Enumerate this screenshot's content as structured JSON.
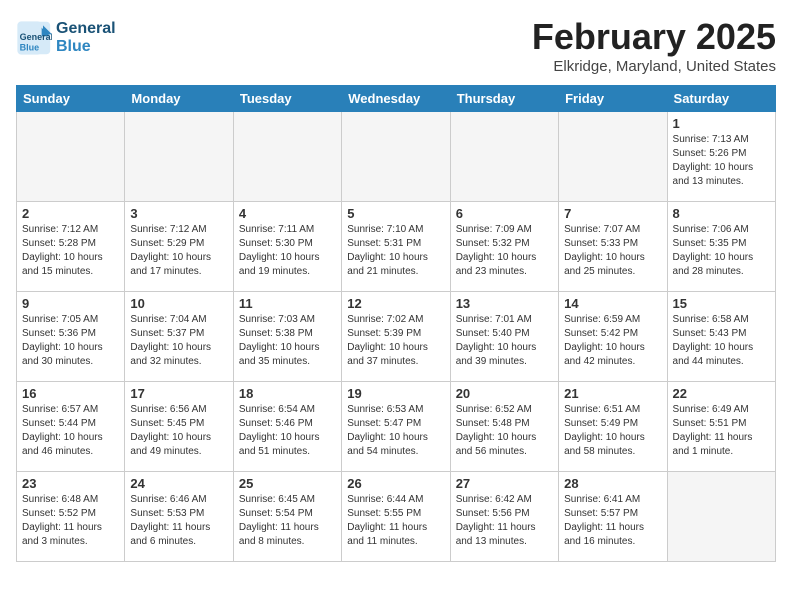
{
  "header": {
    "logo_line1": "General",
    "logo_line2": "Blue",
    "title": "February 2025",
    "subtitle": "Elkridge, Maryland, United States"
  },
  "weekdays": [
    "Sunday",
    "Monday",
    "Tuesday",
    "Wednesday",
    "Thursday",
    "Friday",
    "Saturday"
  ],
  "weeks": [
    [
      {
        "day": "",
        "info": ""
      },
      {
        "day": "",
        "info": ""
      },
      {
        "day": "",
        "info": ""
      },
      {
        "day": "",
        "info": ""
      },
      {
        "day": "",
        "info": ""
      },
      {
        "day": "",
        "info": ""
      },
      {
        "day": "1",
        "info": "Sunrise: 7:13 AM\nSunset: 5:26 PM\nDaylight: 10 hours\nand 13 minutes."
      }
    ],
    [
      {
        "day": "2",
        "info": "Sunrise: 7:12 AM\nSunset: 5:28 PM\nDaylight: 10 hours\nand 15 minutes."
      },
      {
        "day": "3",
        "info": "Sunrise: 7:12 AM\nSunset: 5:29 PM\nDaylight: 10 hours\nand 17 minutes."
      },
      {
        "day": "4",
        "info": "Sunrise: 7:11 AM\nSunset: 5:30 PM\nDaylight: 10 hours\nand 19 minutes."
      },
      {
        "day": "5",
        "info": "Sunrise: 7:10 AM\nSunset: 5:31 PM\nDaylight: 10 hours\nand 21 minutes."
      },
      {
        "day": "6",
        "info": "Sunrise: 7:09 AM\nSunset: 5:32 PM\nDaylight: 10 hours\nand 23 minutes."
      },
      {
        "day": "7",
        "info": "Sunrise: 7:07 AM\nSunset: 5:33 PM\nDaylight: 10 hours\nand 25 minutes."
      },
      {
        "day": "8",
        "info": "Sunrise: 7:06 AM\nSunset: 5:35 PM\nDaylight: 10 hours\nand 28 minutes."
      }
    ],
    [
      {
        "day": "9",
        "info": "Sunrise: 7:05 AM\nSunset: 5:36 PM\nDaylight: 10 hours\nand 30 minutes."
      },
      {
        "day": "10",
        "info": "Sunrise: 7:04 AM\nSunset: 5:37 PM\nDaylight: 10 hours\nand 32 minutes."
      },
      {
        "day": "11",
        "info": "Sunrise: 7:03 AM\nSunset: 5:38 PM\nDaylight: 10 hours\nand 35 minutes."
      },
      {
        "day": "12",
        "info": "Sunrise: 7:02 AM\nSunset: 5:39 PM\nDaylight: 10 hours\nand 37 minutes."
      },
      {
        "day": "13",
        "info": "Sunrise: 7:01 AM\nSunset: 5:40 PM\nDaylight: 10 hours\nand 39 minutes."
      },
      {
        "day": "14",
        "info": "Sunrise: 6:59 AM\nSunset: 5:42 PM\nDaylight: 10 hours\nand 42 minutes."
      },
      {
        "day": "15",
        "info": "Sunrise: 6:58 AM\nSunset: 5:43 PM\nDaylight: 10 hours\nand 44 minutes."
      }
    ],
    [
      {
        "day": "16",
        "info": "Sunrise: 6:57 AM\nSunset: 5:44 PM\nDaylight: 10 hours\nand 46 minutes."
      },
      {
        "day": "17",
        "info": "Sunrise: 6:56 AM\nSunset: 5:45 PM\nDaylight: 10 hours\nand 49 minutes."
      },
      {
        "day": "18",
        "info": "Sunrise: 6:54 AM\nSunset: 5:46 PM\nDaylight: 10 hours\nand 51 minutes."
      },
      {
        "day": "19",
        "info": "Sunrise: 6:53 AM\nSunset: 5:47 PM\nDaylight: 10 hours\nand 54 minutes."
      },
      {
        "day": "20",
        "info": "Sunrise: 6:52 AM\nSunset: 5:48 PM\nDaylight: 10 hours\nand 56 minutes."
      },
      {
        "day": "21",
        "info": "Sunrise: 6:51 AM\nSunset: 5:49 PM\nDaylight: 10 hours\nand 58 minutes."
      },
      {
        "day": "22",
        "info": "Sunrise: 6:49 AM\nSunset: 5:51 PM\nDaylight: 11 hours\nand 1 minute."
      }
    ],
    [
      {
        "day": "23",
        "info": "Sunrise: 6:48 AM\nSunset: 5:52 PM\nDaylight: 11 hours\nand 3 minutes."
      },
      {
        "day": "24",
        "info": "Sunrise: 6:46 AM\nSunset: 5:53 PM\nDaylight: 11 hours\nand 6 minutes."
      },
      {
        "day": "25",
        "info": "Sunrise: 6:45 AM\nSunset: 5:54 PM\nDaylight: 11 hours\nand 8 minutes."
      },
      {
        "day": "26",
        "info": "Sunrise: 6:44 AM\nSunset: 5:55 PM\nDaylight: 11 hours\nand 11 minutes."
      },
      {
        "day": "27",
        "info": "Sunrise: 6:42 AM\nSunset: 5:56 PM\nDaylight: 11 hours\nand 13 minutes."
      },
      {
        "day": "28",
        "info": "Sunrise: 6:41 AM\nSunset: 5:57 PM\nDaylight: 11 hours\nand 16 minutes."
      },
      {
        "day": "",
        "info": ""
      }
    ]
  ]
}
